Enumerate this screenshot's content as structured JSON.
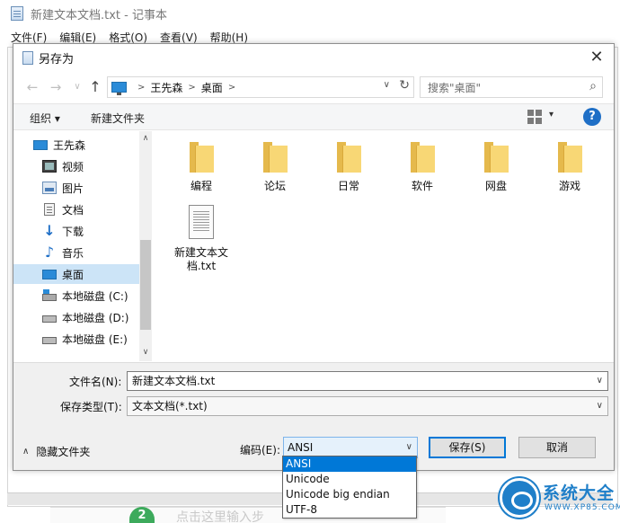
{
  "notepad": {
    "title": "新建文本文档.txt - 记事本",
    "menu": [
      "文件(F)",
      "编辑(E)",
      "格式(O)",
      "查看(V)",
      "帮助(H)"
    ]
  },
  "background_page": {
    "step_number": "2",
    "partial_text": "点击这里输入步"
  },
  "dialog": {
    "title": "另存为",
    "close_glyph": "✕",
    "nav": {
      "back": "←",
      "forward": "→",
      "recent": "∨",
      "up": "↑"
    },
    "address": {
      "crumbs": [
        "王先森",
        "桌面"
      ],
      "separator": ">",
      "dropdown": "∨",
      "refresh": "↻"
    },
    "search": {
      "placeholder": "搜索\"桌面\"",
      "icon": "⌕"
    },
    "toolbar": {
      "organize": "组织 ▾",
      "new_folder": "新建文件夹",
      "view_drop": "▾",
      "help": "?"
    },
    "nav_pane": {
      "items": [
        {
          "label": "王先森",
          "icon": "computer-icon"
        },
        {
          "label": "视频",
          "icon": "video-icon"
        },
        {
          "label": "图片",
          "icon": "pictures-icon"
        },
        {
          "label": "文档",
          "icon": "documents-icon"
        },
        {
          "label": "下载",
          "icon": "download-icon"
        },
        {
          "label": "音乐",
          "icon": "music-icon"
        },
        {
          "label": "桌面",
          "icon": "desktop-icon",
          "selected": true
        },
        {
          "label": "本地磁盘 (C:)",
          "icon": "system-drive-icon"
        },
        {
          "label": "本地磁盘 (D:)",
          "icon": "drive-icon"
        },
        {
          "label": "本地磁盘 (E:)",
          "icon": "drive-icon"
        }
      ],
      "scroll_up": "∧",
      "scroll_down": "∨"
    },
    "files": [
      {
        "label": "编程",
        "type": "folder"
      },
      {
        "label": "论坛",
        "type": "folder"
      },
      {
        "label": "日常",
        "type": "folder"
      },
      {
        "label": "软件",
        "type": "folder"
      },
      {
        "label": "网盘",
        "type": "folder"
      },
      {
        "label": "游戏",
        "type": "folder"
      },
      {
        "label": "新建文本文档.txt",
        "label_line1": "新建文本文",
        "label_line2": "档.txt",
        "type": "text-file"
      }
    ],
    "bottom": {
      "filename_label": "文件名(N):",
      "filename_value": "新建文本文档.txt",
      "filetype_label": "保存类型(T):",
      "filetype_value": "文本文档(*.txt)",
      "hide_folders": "隐藏文件夹",
      "hide_chevron": "∧",
      "encoding_label": "编码(E):",
      "encoding_value": "ANSI",
      "encoding_options": [
        "ANSI",
        "Unicode",
        "Unicode big endian",
        "UTF-8"
      ],
      "save_button": "保存(S)",
      "cancel_button": "取消",
      "combo_drop": "∨"
    }
  },
  "watermark": {
    "brand": "系统大全",
    "url": "WWW.XP85.COM"
  },
  "colors": {
    "accent": "#0078d7",
    "selection": "#cce4f7",
    "folder": "#f8d775",
    "help": "#1f6fc6",
    "watermark": "#1f7fc9"
  }
}
